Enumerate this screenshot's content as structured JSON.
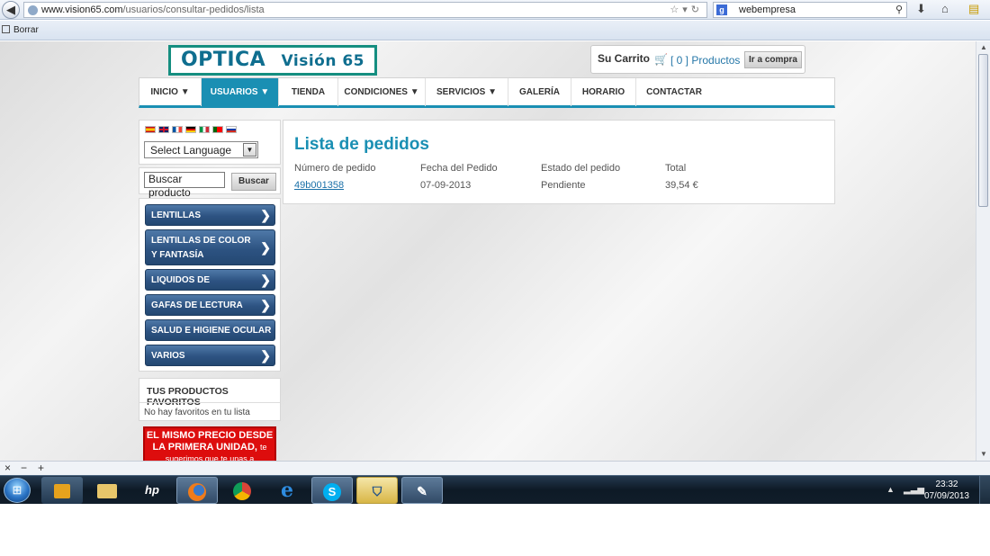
{
  "browser": {
    "url_domain": "www.vision65.com",
    "url_path": "/usuarios/consultar-pedidos/lista",
    "search_engine_icon": "g-icon",
    "search_value": "webempresa",
    "bookmark_label": "Borrar"
  },
  "site": {
    "logo_main": "OPTICA",
    "logo_sub": "Visión 65",
    "cart": {
      "title": "Su Carrito",
      "count_text": "[ 0 ] Productos",
      "button_label": "Ir a compra"
    },
    "menu": [
      {
        "label": "INICIO ▼"
      },
      {
        "label": "USUARIOS ▼"
      },
      {
        "label": "TIENDA"
      },
      {
        "label": "CONDICIONES ▼"
      },
      {
        "label": "SERVICIOS ▼"
      },
      {
        "label": "GALERÍA"
      },
      {
        "label": "HORARIO"
      },
      {
        "label": "CONTACTAR"
      }
    ],
    "language_select": "Select Language",
    "product_search": {
      "value": "Buscar producto",
      "button_label": "Buscar"
    },
    "categories": [
      {
        "label": "LENTILLAS"
      },
      {
        "label": "LENTILLAS DE COLOR Y FANTASÍA"
      },
      {
        "label": "LIQUIDOS DE LENTILLAS"
      },
      {
        "label": "GAFAS DE LECTURA"
      },
      {
        "label": "SALUD E HIGIENE OCULAR"
      },
      {
        "label": "VARIOS"
      }
    ],
    "favorites": {
      "title": "TUS PRODUCTOS FAVORITOS",
      "empty_text": "No hay favoritos en tu lista"
    },
    "promo": {
      "line1": "EL MISMO PRECIO DESDE",
      "line2": "LA PRIMERA UNIDAD,",
      "line2_small": "te",
      "line3": "sugerimos que te unas a"
    },
    "orders": {
      "title": "Lista de pedidos",
      "columns": [
        "Número de pedido",
        "Fecha del Pedido",
        "Estado del pedido",
        "Total"
      ],
      "rows": [
        {
          "number": "49b001358",
          "date": "07-09-2013",
          "status": "Pendiente",
          "total": "39,54 €"
        }
      ]
    }
  },
  "taskbar": {
    "time": "23:32",
    "date": "07/09/2013",
    "apps": [
      "media-player-icon",
      "file-explorer-icon",
      "hp-icon",
      "firefox-icon",
      "chrome-icon",
      "internet-explorer-icon",
      "skype-icon",
      "security-shield-icon",
      "app-icon"
    ]
  },
  "colors": {
    "accent": "#1a8fb3",
    "category_blue": "#2d5382",
    "promo_red": "#dd0d0d",
    "logo_green": "#158e80"
  }
}
